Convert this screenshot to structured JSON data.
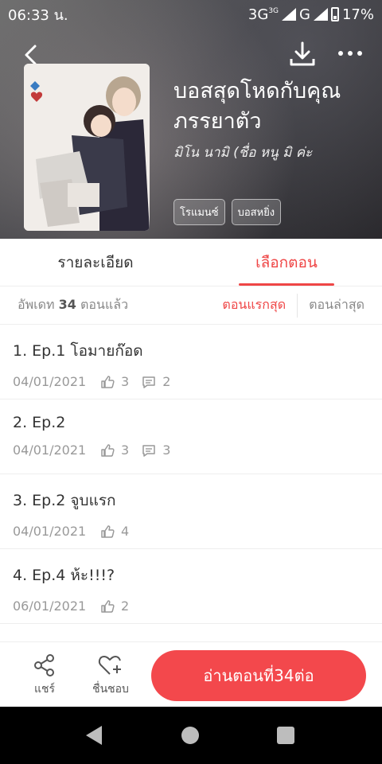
{
  "status_bar": {
    "time": "06:33 น.",
    "network_1": "3G",
    "network_1_small": "3G",
    "network_2": "G",
    "battery": "17%"
  },
  "header": {
    "title": "บอสสุดโหดกับคุณภรรยาตัว",
    "author": "มิโน นามิ (ชื่อ หนู มิ ค่ะ",
    "tags": [
      "โรแมนซ์",
      "บอสหยิ่ง"
    ]
  },
  "tabs": [
    {
      "label": "รายละเอียด",
      "active": false
    },
    {
      "label": "เลือกตอน",
      "active": true
    }
  ],
  "sort_bar": {
    "update_prefix": "อัพเดท",
    "update_count": "34",
    "update_suffix": "ตอนแล้ว",
    "first_label": "ตอนแรกสุด",
    "latest_label": "ตอนล่าสุด"
  },
  "episodes": [
    {
      "title": "1. Ep.1 โอมายก๊อด",
      "date": "04/01/2021",
      "likes": "3",
      "comments": "2"
    },
    {
      "title": "2. Ep.2",
      "date": "04/01/2021",
      "likes": "3",
      "comments": "3"
    },
    {
      "title": "3. Ep.2 จูบแรก",
      "date": "04/01/2021",
      "likes": "4"
    },
    {
      "title": "4. Ep.4 ห้ะ!!!?",
      "date": "06/01/2021",
      "likes": "2"
    }
  ],
  "bottom_bar": {
    "share_label": "แชร์",
    "like_label": "ชื่นชอบ",
    "read_button": "อ่านตอนที่34ต่อ"
  },
  "colors": {
    "accent": "#ef4646",
    "button": "#f3484c"
  },
  "icons": [
    "back-icon",
    "download-icon",
    "more-icon",
    "like-icon",
    "comment-icon",
    "share-icon",
    "heart-plus-icon"
  ]
}
